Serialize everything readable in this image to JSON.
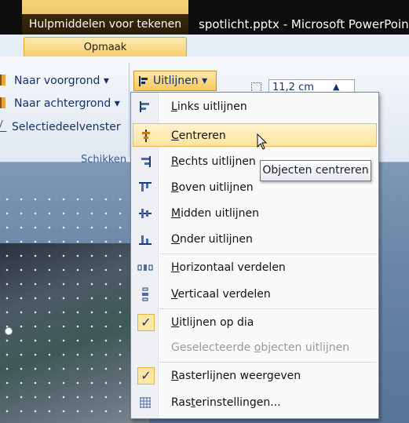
{
  "titlebar": {
    "context_tab": "Hulpmiddelen voor tekenen",
    "title": "spotlicht.pptx - Microsoft PowerPoint"
  },
  "ribbon": {
    "active_tab": "Opmaak",
    "items": {
      "voorgrond": "Naar voorgrond ▾",
      "achtergrond": "Naar achtergrond ▾",
      "selectie": "Selectiedeelvenster",
      "uitlijnen": "Uitlijnen ▾"
    },
    "group_label": "Schikken",
    "size_value": "11,2 cm",
    "stepper_up": "▲"
  },
  "menu": {
    "items": [
      {
        "label": "Links uitlijnen",
        "mn": "L",
        "rest": "inks uitlijnen",
        "icon": "align-left-icon"
      },
      {
        "label": "Centreren",
        "mn": "C",
        "rest": "entreren",
        "icon": "align-center-icon"
      },
      {
        "label": "Rechts uitlijnen",
        "mn": "R",
        "rest": "echts uitlijnen",
        "icon": "align-right-icon"
      },
      {
        "label": "Boven uitlijnen",
        "mn": "B",
        "rest": "oven uitlijnen",
        "icon": "align-top-icon"
      },
      {
        "label": "Midden uitlijnen",
        "mn": "M",
        "rest": "idden uitlijnen",
        "icon": "align-middle-icon"
      },
      {
        "label": "Onder uitlijnen",
        "mn": "O",
        "rest": "nder uitlijnen",
        "icon": "align-bottom-icon"
      },
      {
        "label": "Horizontaal verdelen",
        "mn": "H",
        "rest": "orizontaal verdelen",
        "icon": "distribute-horizontal-icon"
      },
      {
        "label": "Verticaal verdelen",
        "mn": "V",
        "rest": "erticaal verdelen",
        "icon": "distribute-vertical-icon"
      },
      {
        "label": "Uitlijnen op dia",
        "mn": "U",
        "rest": "itlijnen op dia",
        "checked": true
      },
      {
        "label": "Geselecteerde objecten uitlijnen",
        "pre": "Geselecteerde ",
        "mn": "o",
        "rest": "bjecten uitlijnen",
        "disabled": true
      },
      {
        "label": "Rasterlijnen weergeven",
        "mn": "R",
        "rest": "asterlijnen weergeven",
        "checked": true
      },
      {
        "label": "Rasterinstellingen...",
        "pre": "Ras",
        "mn": "t",
        "rest": "erinstellingen...",
        "icon": "grid-settings-icon"
      }
    ],
    "check_mark": "✓"
  },
  "tooltip": "Objecten centreren",
  "colors": {
    "highlight": "#ffe49a",
    "accent": "#f6c95c",
    "titlebar": "#0d0d0d"
  }
}
